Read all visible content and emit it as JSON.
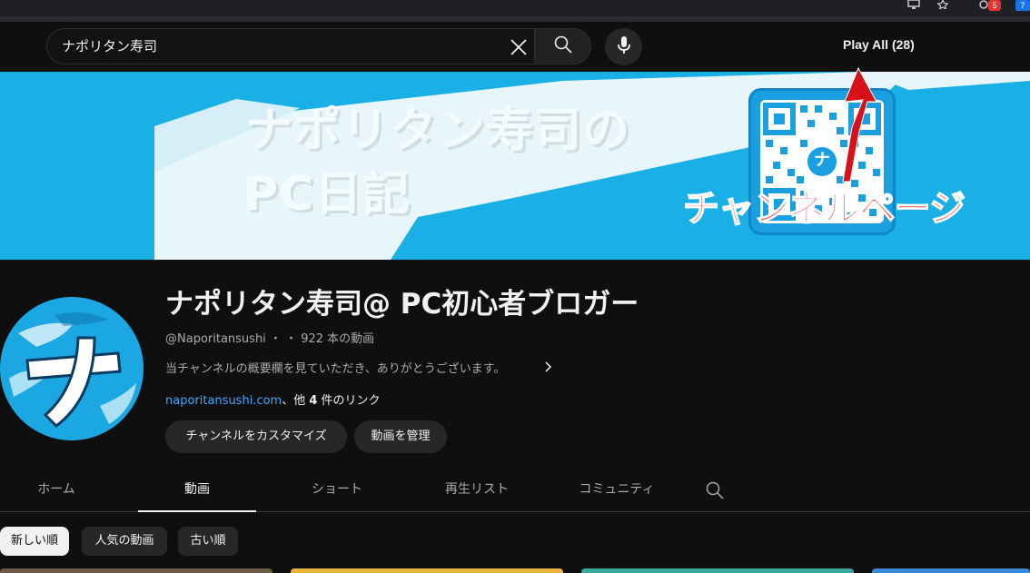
{
  "browser": {
    "notification_count": "5",
    "extension_badge": "7"
  },
  "search": {
    "value": "ナポリタン寿司"
  },
  "header": {
    "play_all_label": "Play All (28)"
  },
  "banner": {
    "line1": "ナポリタン寿司の",
    "line2": "PC日記",
    "annotation": "チャンネルページ",
    "qr_letter": "ナ"
  },
  "channel": {
    "name": "ナポリタン寿司@ PC初心者ブロガー",
    "handle": "@Naporitansushi",
    "meta_sep": " ・ ・ ",
    "video_count": "922 本の動画",
    "description": "当チャンネルの概要欄を見ていただき、ありがとうございます。",
    "link_text": "naporitansushi.com",
    "link_suffix_pre": "、他 ",
    "link_count": "4",
    "link_suffix_post": " 件のリンク",
    "customize_label": "チャンネルをカスタマイズ",
    "manage_label": "動画を管理",
    "avatar_letter": "ナ"
  },
  "tabs": [
    {
      "label": "ホーム",
      "active": false
    },
    {
      "label": "動画",
      "active": true
    },
    {
      "label": "ショート",
      "active": false
    },
    {
      "label": "再生リスト",
      "active": false
    },
    {
      "label": "コミュニティ",
      "active": false
    }
  ],
  "chips": [
    {
      "label": "新しい順",
      "active": true
    },
    {
      "label": "人気の動画",
      "active": false
    },
    {
      "label": "古い順",
      "active": false
    }
  ],
  "colors": {
    "background": "#0f0f0f",
    "banner_blue": "#1ab0e6",
    "link_blue": "#3ea6ff",
    "annotation_red": "#e3141c"
  },
  "icons": [
    "monitor-icon",
    "star-icon",
    "extension-icon",
    "clear-icon",
    "search-icon",
    "mic-icon",
    "chevron-right-icon",
    "tab-search-icon"
  ]
}
